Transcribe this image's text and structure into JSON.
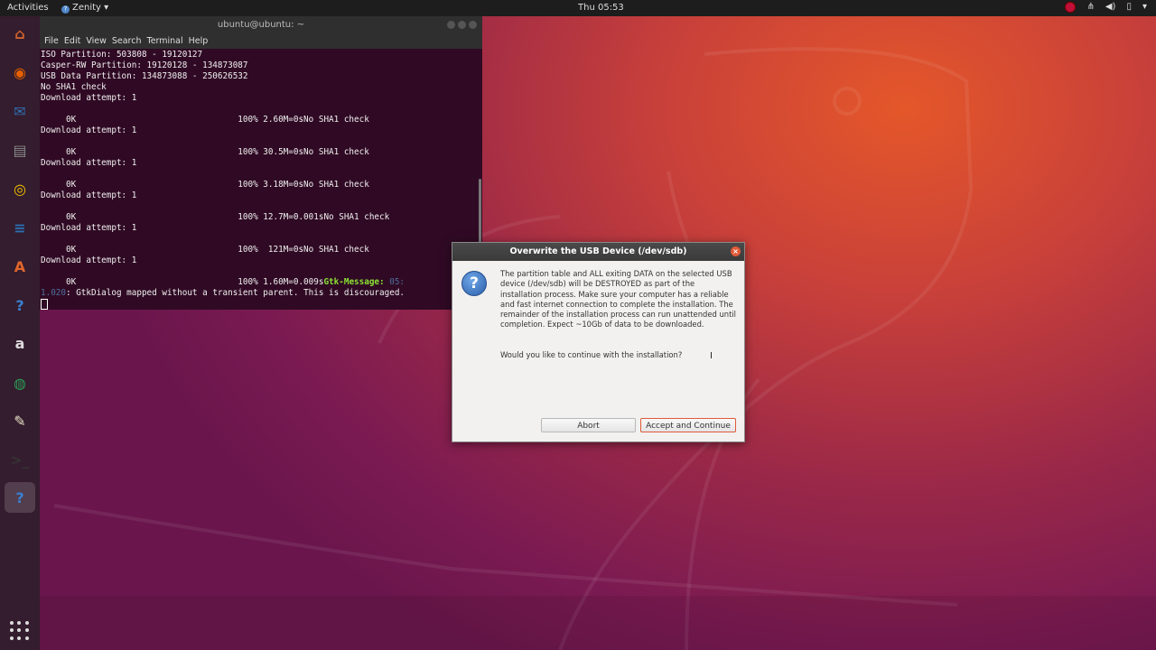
{
  "topbar": {
    "activities": "Activities",
    "app_name": "Zenity",
    "clock": "Thu 05:53"
  },
  "dock": {
    "items": [
      {
        "name": "files-home-icon",
        "glyph": "⌂",
        "color": "#d0622c"
      },
      {
        "name": "firefox-icon",
        "glyph": "◉",
        "color": "#e66000"
      },
      {
        "name": "thunderbird-icon",
        "glyph": "✉",
        "color": "#2f6fb4"
      },
      {
        "name": "files-icon",
        "glyph": "▤",
        "color": "#888888"
      },
      {
        "name": "rhythmbox-icon",
        "glyph": "◎",
        "color": "#f3c300"
      },
      {
        "name": "libreoffice-writer-icon",
        "glyph": "≡",
        "color": "#2a6db0"
      },
      {
        "name": "software-center-icon",
        "glyph": "A",
        "color": "#e0662a"
      },
      {
        "name": "help-icon",
        "glyph": "?",
        "color": "#3b7fd1"
      },
      {
        "name": "amazon-icon",
        "glyph": "a",
        "color": "#dddddd"
      },
      {
        "name": "browser-globe-icon",
        "glyph": "◍",
        "color": "#2b9a55"
      },
      {
        "name": "text-editor-icon",
        "glyph": "✎",
        "color": "#e8e0c8"
      },
      {
        "name": "terminal-icon",
        "glyph": ">_",
        "color": "#333333"
      },
      {
        "name": "help-active-icon",
        "glyph": "?",
        "color": "#3b7fd1"
      }
    ]
  },
  "terminal": {
    "title": "ubuntu@ubuntu: ~",
    "menu": [
      "File",
      "Edit",
      "View",
      "Search",
      "Terminal",
      "Help"
    ],
    "lines": [
      "ISO Partition: 503808 - 19120127",
      "Casper-RW Partition: 19120128 - 134873087",
      "USB Data Partition: 134873088 - 250626532",
      "No SHA1 check",
      "Download attempt: 1",
      "",
      "     0K                                100% 2.60M=0sNo SHA1 check",
      "Download attempt: 1",
      "",
      "     0K                                100% 30.5M=0sNo SHA1 check",
      "Download attempt: 1",
      "",
      "     0K                                100% 3.18M=0sNo SHA1 check",
      "Download attempt: 1",
      "",
      "     0K                                100% 12.7M=0.001sNo SHA1 check",
      "Download attempt: 1",
      "",
      "     0K                                100%  121M=0sNo SHA1 check",
      "Download attempt: 1",
      ""
    ],
    "gtk_line_prefix": "     0K                                100% 1.60M=0.009s",
    "gtk_label": "Gtk-Message:",
    "gtk_time": " 05:",
    "gtk_line2_dim": "1.020",
    "gtk_line2_rest": ": GtkDialog mapped without a transient parent. This is discouraged."
  },
  "dialog": {
    "title": "Overwrite the USB Device (/dev/sdb)",
    "message": "The partition table and ALL exiting DATA on the selected USB device (/dev/sdb) will be DESTROYED as part of the installation process. Make sure your computer has a reliable and fast internet connection to complete the installation. The remainder of the installation process can run unattended until completion. Expect ~10Gb of data to be downloaded.",
    "question": "Would you like to continue with the installation?",
    "abort_label": "Abort",
    "accept_label": "Accept and Continue",
    "accent": "#e05a38"
  }
}
